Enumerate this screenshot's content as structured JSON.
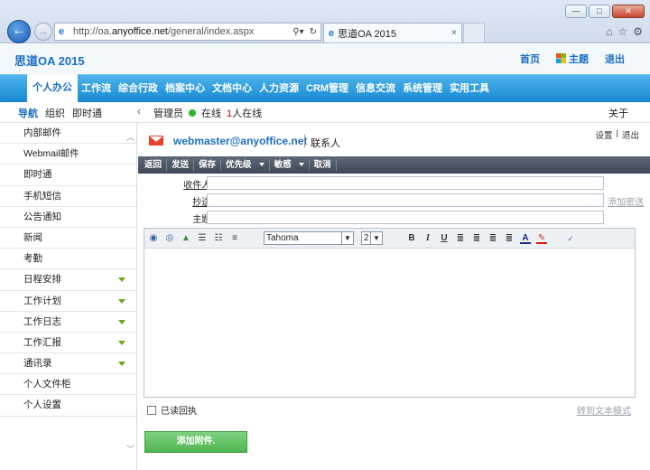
{
  "browser": {
    "url_prefix": "http://oa.",
    "url_host": "anyoffice.net",
    "url_path": "/general/index.aspx",
    "tab_title": "思道OA 2015",
    "tab_close": "×",
    "window_minimize": "—",
    "window_maximize": "□",
    "window_close": "✕"
  },
  "app": {
    "brand": "思道OA 2015",
    "toplinks": {
      "home": "首页",
      "theme": "主题",
      "logout": "退出"
    }
  },
  "modules": [
    "个人办公",
    "工作流",
    "综合行政",
    "档案中心",
    "文档中心",
    "人力资源",
    "CRM管理",
    "信息交流",
    "系统管理",
    "实用工具"
  ],
  "subbar": {
    "tabs": [
      "导航",
      "组织",
      "即时通"
    ],
    "user": "管理员",
    "online": "在线",
    "online_count": "1",
    "online_suffix": "人在线",
    "about": "关于"
  },
  "sidebar": {
    "items": [
      {
        "label": "内部邮件",
        "expand": false
      },
      {
        "label": "Webmail邮件",
        "expand": false
      },
      {
        "label": "即时通",
        "expand": false
      },
      {
        "label": "手机短信",
        "expand": false
      },
      {
        "label": "公告通知",
        "expand": false
      },
      {
        "label": "新闻",
        "expand": false
      },
      {
        "label": "考勤",
        "expand": false
      },
      {
        "label": "日程安排",
        "expand": true
      },
      {
        "label": "工作计划",
        "expand": true
      },
      {
        "label": "工作日志",
        "expand": true
      },
      {
        "label": "工作汇报",
        "expand": true
      },
      {
        "label": "通讯录",
        "expand": true
      },
      {
        "label": "个人文件柜",
        "expand": false
      },
      {
        "label": "个人设置",
        "expand": false
      }
    ]
  },
  "mail": {
    "account": "webmaster@anyoffice.net",
    "contacts": "联系人",
    "settings": "设置",
    "sep": "|",
    "exit": "退出",
    "toolbar": {
      "back": "返回",
      "send": "发送",
      "save": "保存",
      "priority": "优先级",
      "sensitive": "敏感",
      "cancel": "取消"
    },
    "to_label": "收件人:",
    "cc_label": "抄送:",
    "subject_label": "主题:",
    "add_bcc": "添加密送",
    "font_name": "Tahoma",
    "font_size": "2",
    "read_receipt": "已读回执",
    "plain_text": "转到文本模式",
    "attach": "添加附件."
  }
}
